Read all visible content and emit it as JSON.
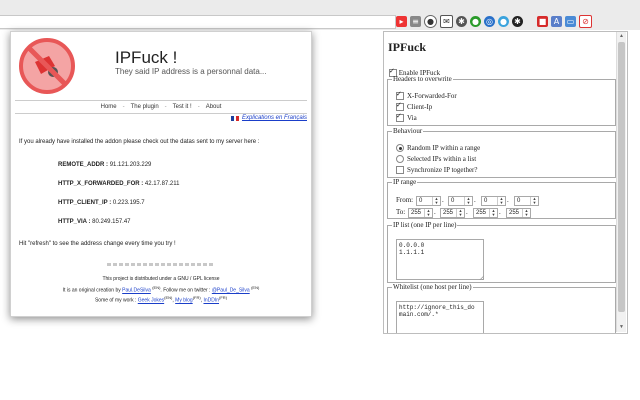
{
  "page": {
    "title": "IPFuck !",
    "subtitle": "They said IP address is a personnal data...",
    "nav": [
      "Home",
      "The plugin",
      "Test it !",
      "About"
    ],
    "lang_link": "Explications en Français",
    "intro": "If you already have installed the addon please check out the datas sent to my server here :",
    "fields": [
      {
        "label": "REMOTE_ADDR :",
        "value": "91.121.203.229"
      },
      {
        "label": "HTTP_X_FORWARDED_FOR :",
        "value": "42.17.87.211"
      },
      {
        "label": "HTTP_CLIENT_IP :",
        "value": "0.223.195.7"
      },
      {
        "label": "HTTP_VIA :",
        "value": "80.249.157.47"
      }
    ],
    "hint": "Hit \"refresh\" to see the address change every time you try !",
    "footer": {
      "license": "This project is distributed under a GNU / GPL license",
      "creation_prefix": "It is an original creation by",
      "author": "Paul.DeSilva",
      "en1": "(EN)",
      "twitter_prefix": ". Follow me on twitter :",
      "twitter": "@Paul_De_Silva",
      "en2": "(EN)",
      "work_prefix": "Some of my work :",
      "work": [
        {
          "name": "Geek Jokes",
          "tag": "(EN)"
        },
        {
          "name": "My blog",
          "tag": "(FR)"
        },
        {
          "name": "InDDIn",
          "tag": "(FR)"
        }
      ]
    }
  },
  "popup": {
    "title": "IPFuck",
    "enable": {
      "label": "Enable IPFuck",
      "checked": true
    },
    "headers": {
      "legend": "Headers to overwrite",
      "items": [
        {
          "label": "X-Forwarded-For",
          "checked": true
        },
        {
          "label": "Client-Ip",
          "checked": true
        },
        {
          "label": "Via",
          "checked": true
        }
      ]
    },
    "behaviour": {
      "legend": "Behaviour",
      "options": [
        {
          "label": "Random IP within a range",
          "selected": true
        },
        {
          "label": "Selected IPs within a list",
          "selected": false
        }
      ],
      "sync": {
        "label": "Synchronize IP together?",
        "checked": false
      }
    },
    "ip_range": {
      "legend": "IP range",
      "from_label": "From:",
      "to_label": "To:",
      "from": [
        "0",
        "0",
        "0",
        "0"
      ],
      "to": [
        "255",
        "255",
        "255",
        "255"
      ],
      "separator": "."
    },
    "ip_list": {
      "legend": "IP list (one IP per line)",
      "value": "0.0.0.0\n1.1.1.1"
    },
    "whitelist": {
      "legend": "Whitelist (one host per line)",
      "value": "http://ignore_this_do\nmain.com/.*"
    }
  },
  "colors": {
    "accent_link": "#1a3ec9",
    "logo_red": "#e85757"
  }
}
